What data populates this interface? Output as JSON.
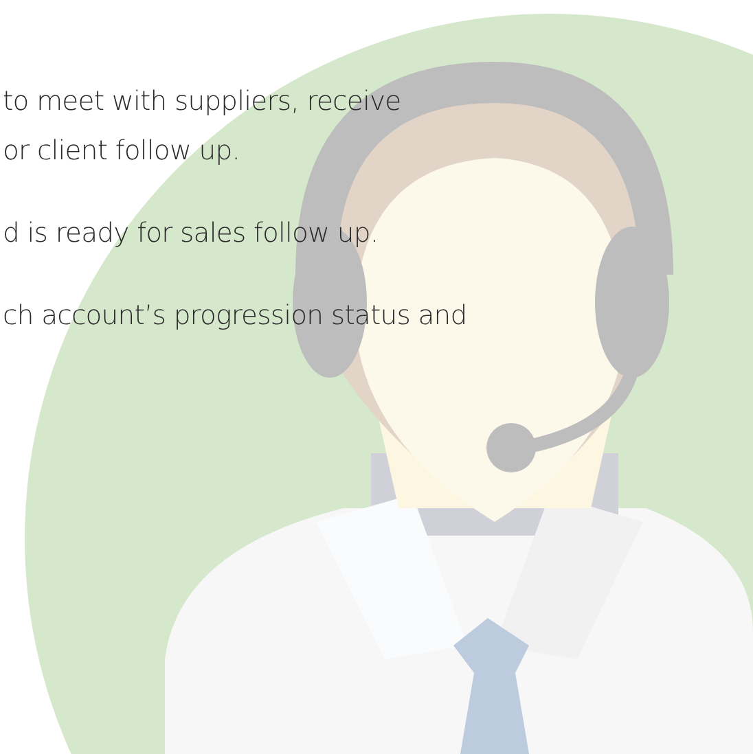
{
  "paragraphs": [
    {
      "lines": [
        "to meet with suppliers, receive",
        "or client follow up."
      ]
    },
    {
      "lines": [
        "d is ready for sales follow up."
      ]
    },
    {
      "lines": [
        "ch account’s progression status and"
      ]
    }
  ]
}
